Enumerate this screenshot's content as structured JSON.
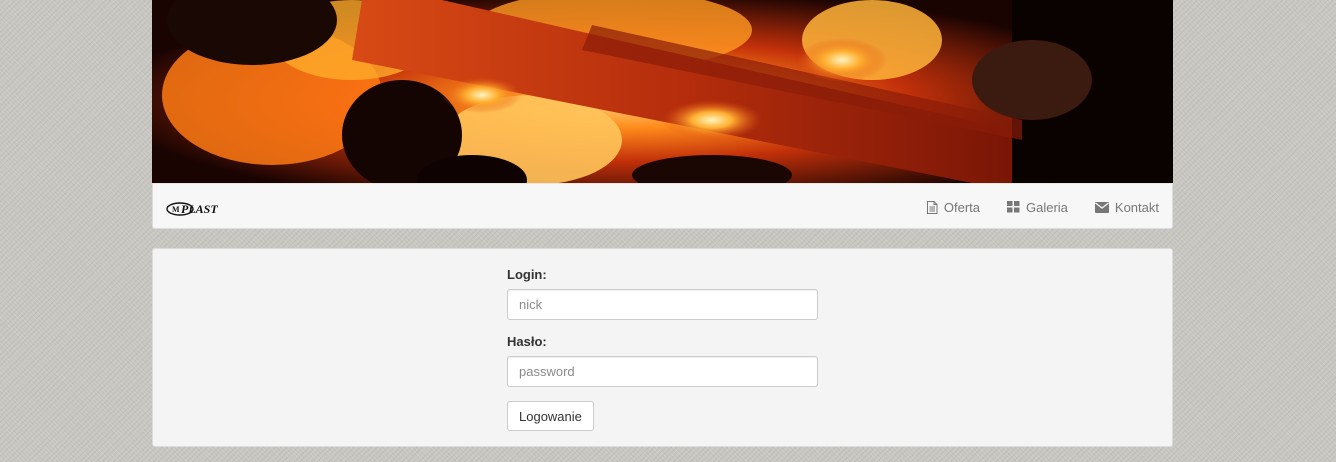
{
  "header": {
    "banner_alt": "fire banner",
    "logo_text": "PLAST",
    "logo_prefix": "M"
  },
  "nav": {
    "items": [
      {
        "label": "Oferta",
        "icon": "document-icon"
      },
      {
        "label": "Galeria",
        "icon": "grid-icon"
      },
      {
        "label": "Kontakt",
        "icon": "envelope-icon"
      }
    ]
  },
  "login_form": {
    "login_label": "Login:",
    "login_placeholder": "nick",
    "password_label": "Hasło:",
    "password_placeholder": "password",
    "submit_label": "Logowanie"
  },
  "colors": {
    "page_background": "#c8c6c1",
    "panel_background": "#f4f4f4",
    "navbar_background": "#f7f7f7",
    "nav_text": "#777777"
  }
}
